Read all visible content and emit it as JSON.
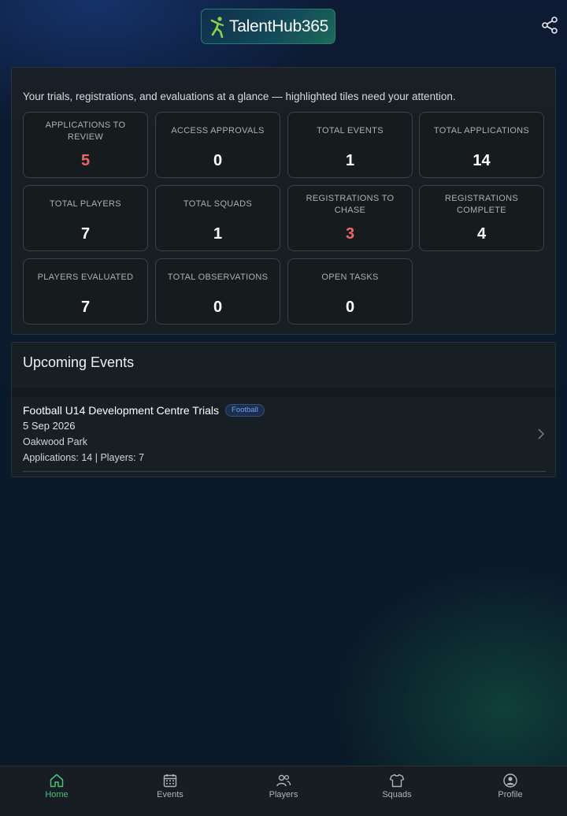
{
  "app": {
    "logo_text": "TalentHub365",
    "share_icon": "share-icon"
  },
  "dashboard": {
    "intro": "Your trials, registrations, and evaluations at a glance — highlighted tiles need your attention.",
    "tiles": [
      {
        "label": "APPLICATIONS TO REVIEW",
        "value": "5",
        "highlight": true
      },
      {
        "label": "ACCESS APPROVALS",
        "value": "0",
        "highlight": false
      },
      {
        "label": "TOTAL EVENTS",
        "value": "1",
        "highlight": false
      },
      {
        "label": "TOTAL APPLICATIONS",
        "value": "14",
        "highlight": false
      },
      {
        "label": "TOTAL PLAYERS",
        "value": "7",
        "highlight": false
      },
      {
        "label": "TOTAL SQUADS",
        "value": "1",
        "highlight": false
      },
      {
        "label": "REGISTRATIONS TO CHASE",
        "value": "3",
        "highlight": true
      },
      {
        "label": "REGISTRATIONS COMPLETE",
        "value": "4",
        "highlight": false
      },
      {
        "label": "PLAYERS EVALUATED",
        "value": "7",
        "highlight": false
      },
      {
        "label": "TOTAL OBSERVATIONS",
        "value": "0",
        "highlight": false
      },
      {
        "label": "OPEN TASKS",
        "value": "0",
        "highlight": false
      }
    ]
  },
  "events": {
    "title": "Upcoming Events",
    "items": [
      {
        "title": "Football U14 Development Centre Trials",
        "badge": "Football",
        "date": "5 Sep 2026",
        "venue": "Oakwood Park",
        "stats": "Applications: 14 | Players: 7"
      }
    ]
  },
  "nav": {
    "items": [
      {
        "label": "Home",
        "icon": "home-icon",
        "active": true
      },
      {
        "label": "Events",
        "icon": "calendar-icon",
        "active": false
      },
      {
        "label": "Players",
        "icon": "users-icon",
        "active": false
      },
      {
        "label": "Squads",
        "icon": "shirt-icon",
        "active": false
      },
      {
        "label": "Profile",
        "icon": "profile-icon",
        "active": false
      }
    ]
  },
  "colors": {
    "accent_green": "#4cc17a",
    "alert_red": "#e8676a",
    "badge_blue": "#6ba3e8"
  }
}
